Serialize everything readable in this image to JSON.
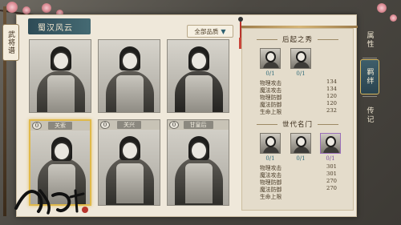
{
  "header": {
    "faction_tab": "蜀汉风云",
    "filter_label": "全部品质"
  },
  "left_tab": {
    "label": "武将谱"
  },
  "cards": [
    {
      "name": "",
      "count": "",
      "selected": false
    },
    {
      "name": "",
      "count": "",
      "selected": false
    },
    {
      "name": "",
      "count": "",
      "selected": false
    },
    {
      "name": "关索",
      "count": "0",
      "selected": true
    },
    {
      "name": "关兴",
      "count": "0",
      "selected": false
    },
    {
      "name": "甘皇后",
      "count": "0",
      "selected": false
    }
  ],
  "info": {
    "section1": {
      "title": "后起之秀",
      "avatars": [
        {
          "name": "hero-avatar-1",
          "progress": "0/1",
          "color": "#2f6b7a"
        },
        {
          "name": "hero-avatar-2",
          "progress": "0/1",
          "color": "#2f6b7a"
        }
      ],
      "stats": [
        {
          "label": "物理攻击",
          "value": "134"
        },
        {
          "label": "魔法攻击",
          "value": "134"
        },
        {
          "label": "物理防御",
          "value": "120"
        },
        {
          "label": "魔法防御",
          "value": "120"
        },
        {
          "label": "生命上限",
          "value": "232"
        }
      ]
    },
    "section2": {
      "title": "世代名门",
      "avatars": [
        {
          "name": "hero-avatar-3",
          "progress": "0/1",
          "color": "#2f6b7a"
        },
        {
          "name": "hero-avatar-4",
          "progress": "0/1",
          "color": "#2f6b7a"
        },
        {
          "name": "hero-avatar-5",
          "progress": "0/1",
          "color": "#7c4fa3"
        }
      ],
      "stats": [
        {
          "label": "物理攻击",
          "value": "301"
        },
        {
          "label": "魔法攻击",
          "value": "301"
        },
        {
          "label": "物理防御",
          "value": "270"
        },
        {
          "label": "魔法防御",
          "value": "270"
        },
        {
          "label": "生命上限",
          "value": ""
        }
      ]
    }
  },
  "side_tabs": [
    {
      "label": "属性",
      "active": false
    },
    {
      "label": "羁绊",
      "active": true
    },
    {
      "label": "传记",
      "active": false
    }
  ],
  "colors": {
    "accent_gold": "#e0b94a",
    "banner_teal": "#2e4b56",
    "progress_teal": "#2f6b7a",
    "progress_purple": "#7c4fa3"
  }
}
